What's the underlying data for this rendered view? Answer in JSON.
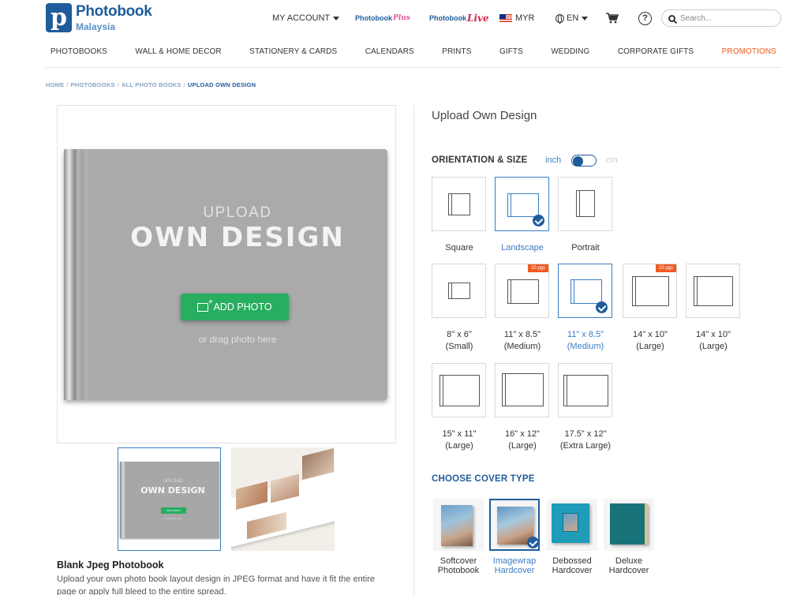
{
  "logo": {
    "mark": "p",
    "name": "Photobook",
    "sub": "Malaysia"
  },
  "header": {
    "account": "MY ACCOUNT",
    "plus_brand": "Photobook",
    "plus_suffix": "Plus",
    "live_brand": "Photobook",
    "live_suffix": "Live",
    "currency": "MYR",
    "language": "EN",
    "help": "?",
    "search_placeholder": "Search..."
  },
  "nav": [
    "PHOTOBOOKS",
    "WALL & HOME DECOR",
    "STATIONERY & CARDS",
    "CALENDARS",
    "PRINTS",
    "GIFTS",
    "WEDDING",
    "CORPORATE GIFTS",
    "PROMOTIONS"
  ],
  "breadcrumb": [
    "HOME",
    "PHOTOBOOKS",
    "ALL PHOTO BOOKS",
    "UPLOAD OWN DESIGN"
  ],
  "preview": {
    "upload": "UPLOAD",
    "own_design": "OWN DESIGN",
    "add_photo": "ADD PHOTO",
    "drag": "or drag photo here",
    "thumb_upload": "UPLOAD",
    "thumb_own": "OWN DESIGN",
    "thumb_add": "ADD PHOTO",
    "thumb_drag": "or drag photo here"
  },
  "description": {
    "title": "Blank Jpeg Photobook",
    "text": "Upload your own photo book layout design in JPEG format and have it fit the entire page or apply full bleed to the entire spread."
  },
  "product": {
    "title": "Upload Own Design",
    "orientation_heading": "ORIENTATION & SIZE",
    "unit_inch": "inch",
    "unit_cm": "cm",
    "orientations": [
      "Square",
      "Landscape",
      "Portrait"
    ],
    "sizes": [
      {
        "line1": "8\" x 6\"",
        "line2": "(Small)",
        "badge": ""
      },
      {
        "line1": "11\" x 8.5\"",
        "line2": "(Medium)",
        "badge": "20 pgs"
      },
      {
        "line1": "11\" x 8.5\"",
        "line2": "(Medium)",
        "badge": ""
      },
      {
        "line1": "14\" x 10\"",
        "line2": "(Large)",
        "badge": "20 pgs"
      },
      {
        "line1": "14\" x 10\"",
        "line2": "(Large)",
        "badge": ""
      },
      {
        "line1": "15\" x 11\"",
        "line2": "(Large)",
        "badge": ""
      },
      {
        "line1": "16\" x 12\"",
        "line2": "(Large)",
        "badge": ""
      },
      {
        "line1": "17.5\" x 12\"",
        "line2": "(Extra Large)",
        "badge": ""
      }
    ],
    "cover_heading": "CHOOSE COVER TYPE",
    "covers": [
      {
        "line1": "Softcover",
        "line2": "Photobook"
      },
      {
        "line1": "Imagewrap",
        "line2": "Hardcover"
      },
      {
        "line1": "Debossed",
        "line2": "Hardcover"
      },
      {
        "line1": "Deluxe",
        "line2": "Hardcover"
      }
    ]
  },
  "colors": {
    "brand_blue": "#1f5c9b",
    "accent_blue": "#3b7dc4",
    "green": "#27ae60",
    "promo_orange": "#f05a22"
  }
}
